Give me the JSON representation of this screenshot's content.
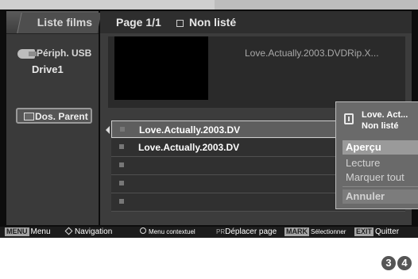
{
  "sidebar": {
    "title": "Liste films",
    "device_label": "Périph. USB",
    "drive_label": "Drive1",
    "parent_button": "Dos. Parent",
    "icons": {
      "device": "usb-icon",
      "parent": "folder-icon"
    }
  },
  "header": {
    "page": "Page 1/1",
    "status": "Non listé"
  },
  "preview": {
    "title": "Love.Actually.2003.DVDRip.X..."
  },
  "file_list": {
    "rows": [
      {
        "name": "Love.Actually.2003.DV",
        "selected": true
      },
      {
        "name": "Love.Actually.2003.DV",
        "selected": false
      },
      {
        "name": "",
        "selected": false
      },
      {
        "name": "",
        "selected": false
      },
      {
        "name": "",
        "selected": false
      }
    ]
  },
  "popup": {
    "title": "Love. Act...",
    "status": "Non listé",
    "items": [
      "Aperçu",
      "Lecture",
      "Marquer tout",
      "Annuler"
    ],
    "active_item": "Aperçu"
  },
  "bottom_bar": {
    "menu_key": "MENU",
    "menu_label": "Menu",
    "nav_label": "Navigation",
    "context_label": "Menu contextuel",
    "pr_key": "PR",
    "page_label": "Déplacer page",
    "mark_key": "MARK",
    "mark_label": "Sélectionner",
    "exit_key": "EXIT",
    "exit_label": "Quitter"
  },
  "page_numbers": [
    "3",
    "4"
  ],
  "colors": {
    "background": "#0d0d0d",
    "panel": "#3c3c3c",
    "popup_highlight": "#9a9a9a"
  }
}
